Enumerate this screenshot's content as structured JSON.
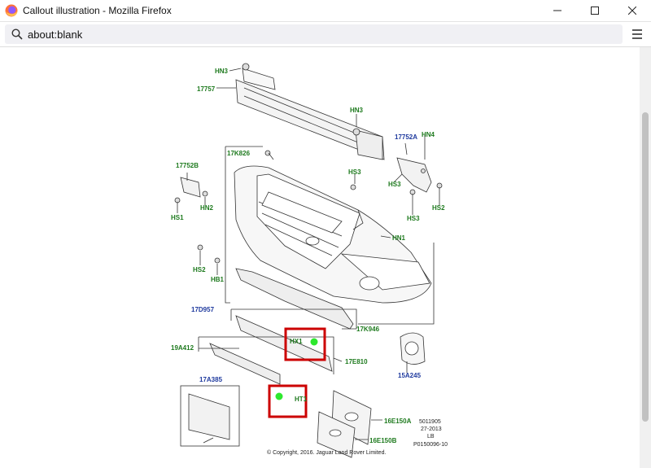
{
  "window": {
    "title": "Callout illustration - Mozilla Firefox"
  },
  "toolbar": {
    "url": "about:blank"
  },
  "diagram": {
    "labels": {
      "hn3_top": "HN3",
      "p17757": "17757",
      "hn3_mid": "HN3",
      "p17752a": "17752A",
      "hn4": "HN4",
      "p17k826": "17K826",
      "p17752b": "17752B",
      "hs3_a": "HS3",
      "hs3_b": "HS3",
      "hs3_c": "HS3",
      "hn2": "HN2",
      "hs1": "HS1",
      "hs2_r": "HS2",
      "hn1": "HN1",
      "hs2_l": "HS2",
      "hb1": "HB1",
      "p17d957": "17D957",
      "p17k946": "17K946",
      "hx1": "HX1",
      "p19a412": "19A412",
      "p17e810": "17E810",
      "p15a245": "15A245",
      "p17a385": "17A385",
      "ht1": "HT1",
      "p16e150a": "16E150A",
      "p16e150b": "16E150B"
    },
    "ref": [
      "5011905",
      "27-2013",
      "LB",
      "P0150096-10"
    ],
    "copyright": "© Copyright, 2016. Jaguar Land Rover Limited."
  },
  "colors": {
    "callout_box": "#cc0000",
    "callout_dot": "#2ee82e",
    "part_label": "#1e7a1e",
    "assembly_label": "#1f3a9e"
  }
}
